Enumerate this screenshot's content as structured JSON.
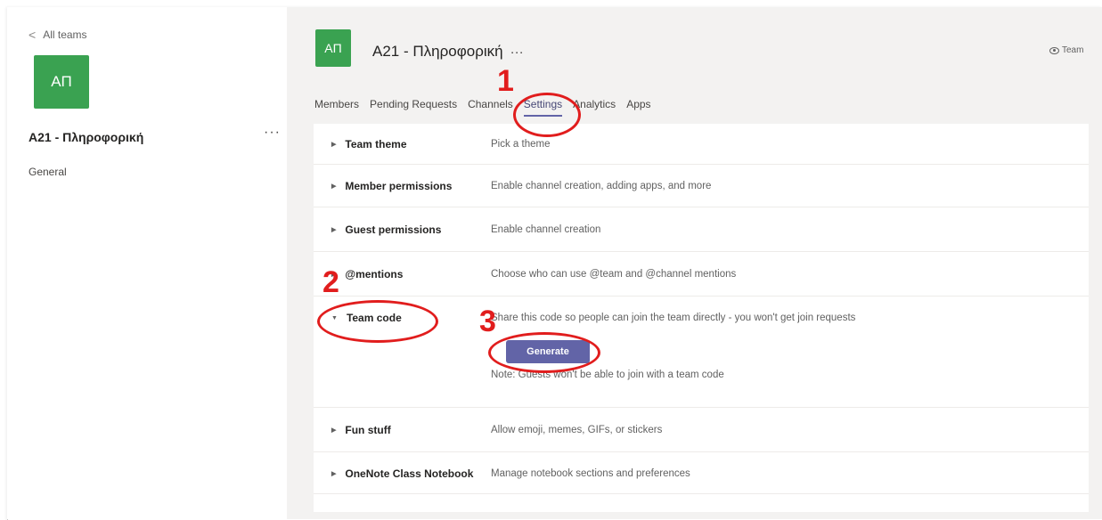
{
  "left_panel": {
    "back_label": "All teams",
    "team_initials": "ΑΠ",
    "team_name": "Α21 - Πληροφορική",
    "more_label": "···",
    "channels": [
      "General"
    ]
  },
  "header": {
    "team_initials": "ΑΠ",
    "team_name": "Α21 - Πληροφορική",
    "more_label": "···",
    "team_view_label": "Team"
  },
  "tabs": [
    "Members",
    "Pending Requests",
    "Channels",
    "Settings",
    "Analytics",
    "Apps"
  ],
  "active_tab": "Settings",
  "settings": [
    {
      "name": "Team theme",
      "desc": "Pick a theme"
    },
    {
      "name": "Member permissions",
      "desc": "Enable channel creation, adding apps, and more"
    },
    {
      "name": "Guest permissions",
      "desc": "Enable channel creation"
    },
    {
      "name": "@mentions",
      "desc": "Choose who can use @team and @channel mentions"
    },
    {
      "name": "Team code",
      "desc": "Share this code so people can join the team directly - you won't get join requests"
    },
    {
      "name": "Fun stuff",
      "desc": "Allow emoji, memes, GIFs, or stickers"
    },
    {
      "name": "OneNote Class Notebook",
      "desc": "Manage notebook sections and preferences"
    }
  ],
  "team_code": {
    "generate_label": "Generate",
    "note": "Note: Guests won't be able to join with a team code"
  },
  "annotations": {
    "step1": "1",
    "step2": "2",
    "step3": "3"
  },
  "colors": {
    "accent": "#6264a7",
    "team_avatar": "#3aa251",
    "annotation": "#e11d1d"
  }
}
